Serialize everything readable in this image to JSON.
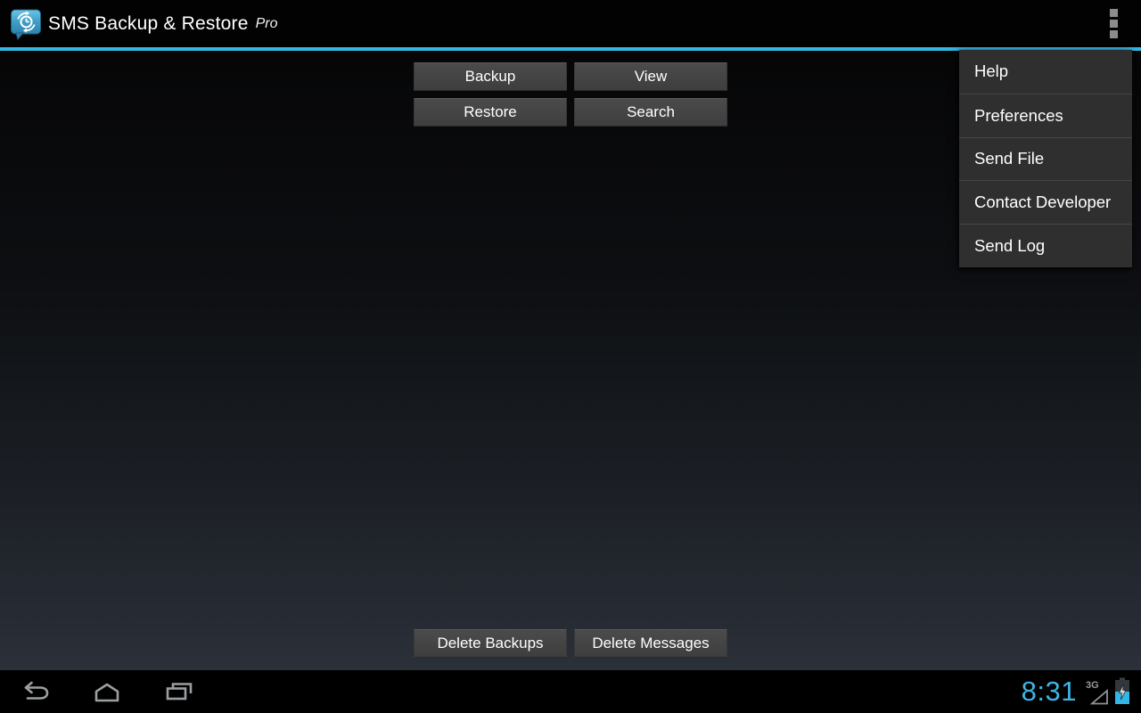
{
  "app": {
    "title": "SMS Backup & Restore",
    "title_suffix": "Pro",
    "icon": "sms-backup-restore-app-icon"
  },
  "action_bar": {
    "overflow_icon": "overflow-menu-icon"
  },
  "main_buttons": [
    {
      "label": "Backup"
    },
    {
      "label": "View"
    },
    {
      "label": "Restore"
    },
    {
      "label": "Search"
    }
  ],
  "bottom_buttons": [
    {
      "label": "Delete Backups"
    },
    {
      "label": "Delete Messages"
    }
  ],
  "overflow_menu": {
    "items": [
      {
        "label": "Help"
      },
      {
        "label": "Preferences"
      },
      {
        "label": "Send File"
      },
      {
        "label": "Contact Developer"
      },
      {
        "label": "Send Log"
      }
    ]
  },
  "nav_bar": {
    "clock": "8:31",
    "network_type": "3G",
    "icons": [
      "back-icon",
      "home-icon",
      "recent-apps-icon",
      "signal-triangle-icon",
      "battery-charging-icon"
    ]
  },
  "colors": {
    "accent_line": "#35b6e2",
    "clock_text": "#3db5e5",
    "action_bar_bg": "#020202",
    "menu_bg": "#2f2f2f",
    "button_face": "#454545",
    "battery_fill": "#33b5e5"
  }
}
